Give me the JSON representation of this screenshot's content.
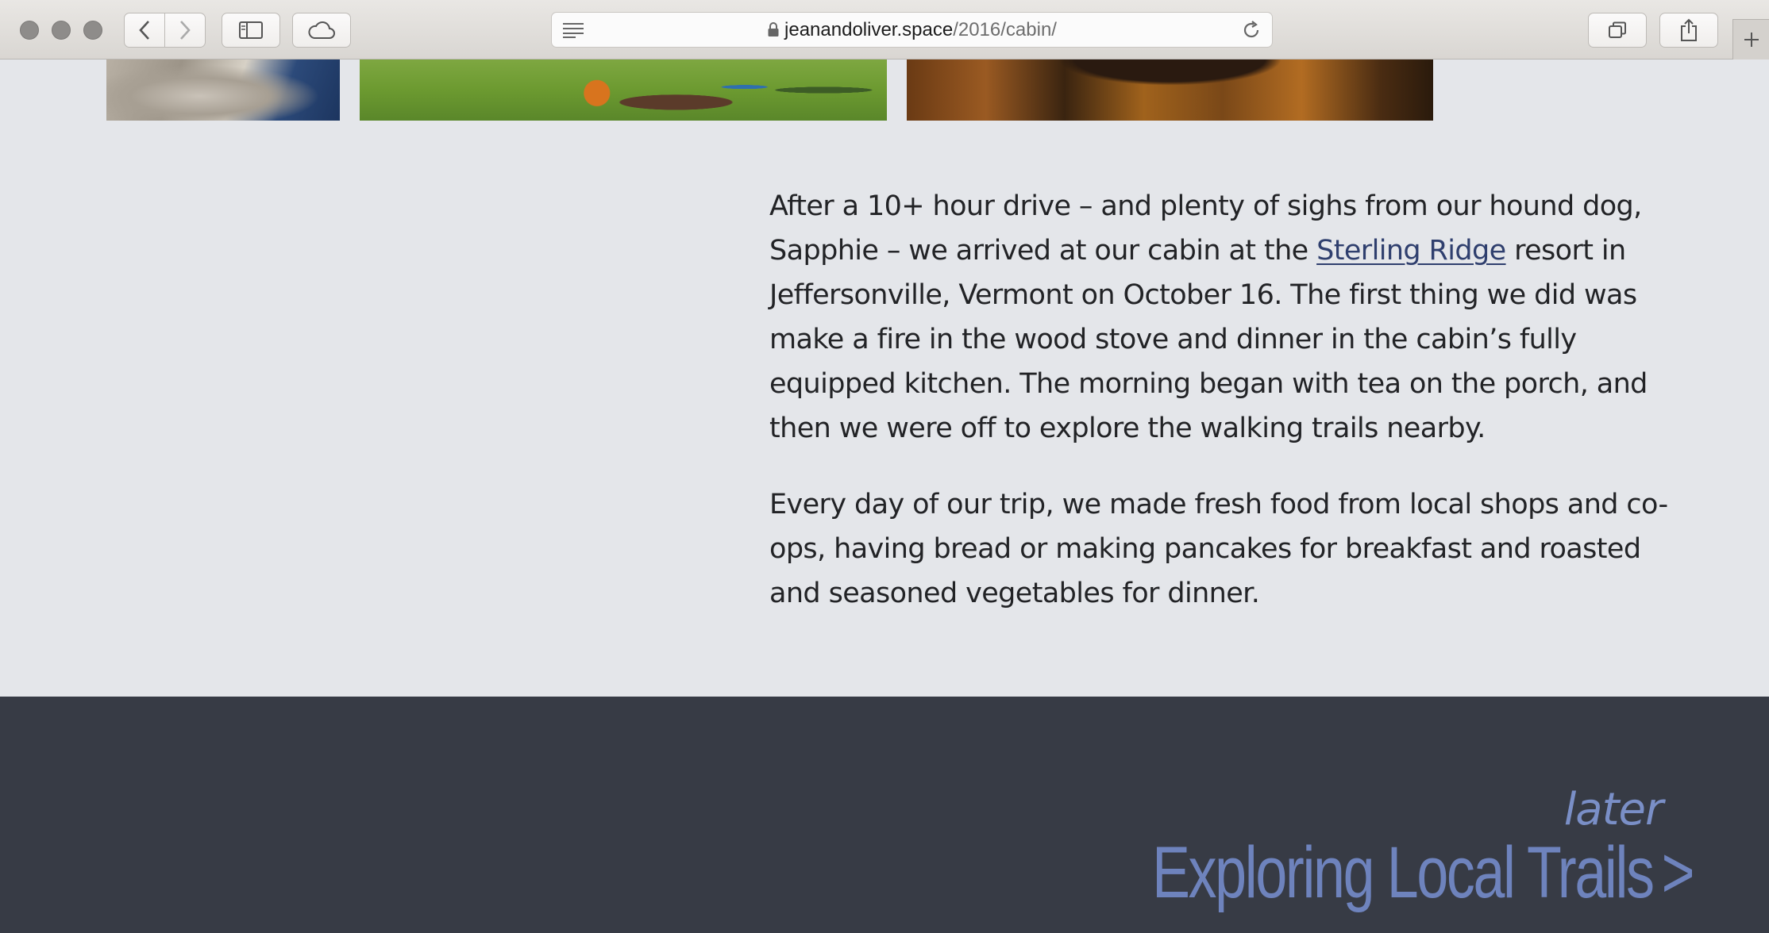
{
  "browser": {
    "url_domain": "jeanandoliver.space",
    "url_path": "/2016/cabin/",
    "icons": [
      "back-icon",
      "forward-icon",
      "sidebar-icon",
      "cloud-icon",
      "reader-icon",
      "lock-icon",
      "reload-icon",
      "tabs-icon",
      "share-icon",
      "plus-icon"
    ]
  },
  "article": {
    "p1_before": "After a 10+ hour drive – and plenty of sighs from our hound dog, Sapphie – we arrived at our cabin at the ",
    "p1_link": "Sterling Ridge",
    "p1_after": " resort in Jeffersonville, Vermont on October 16. The first thing we did was make a fire in the wood stove and dinner in the cabin’s fully equipped kitchen. The morning began with tea on the porch, and then we were off to explore the walking trails nearby.",
    "p2": "Every day of our trip, we made fresh food from local shops and co-ops, having bread or making pancakes for breakfast and roasted and seasoned vegetables for dinner."
  },
  "footer": {
    "later_label": "later",
    "next_title": "Exploring Local Trails",
    "next_chevron": ">"
  },
  "colors": {
    "page_bg": "#e4e6ea",
    "footer_bg": "#373b45",
    "link": "#2f3f6e",
    "footer_link": "#6e83bd"
  }
}
